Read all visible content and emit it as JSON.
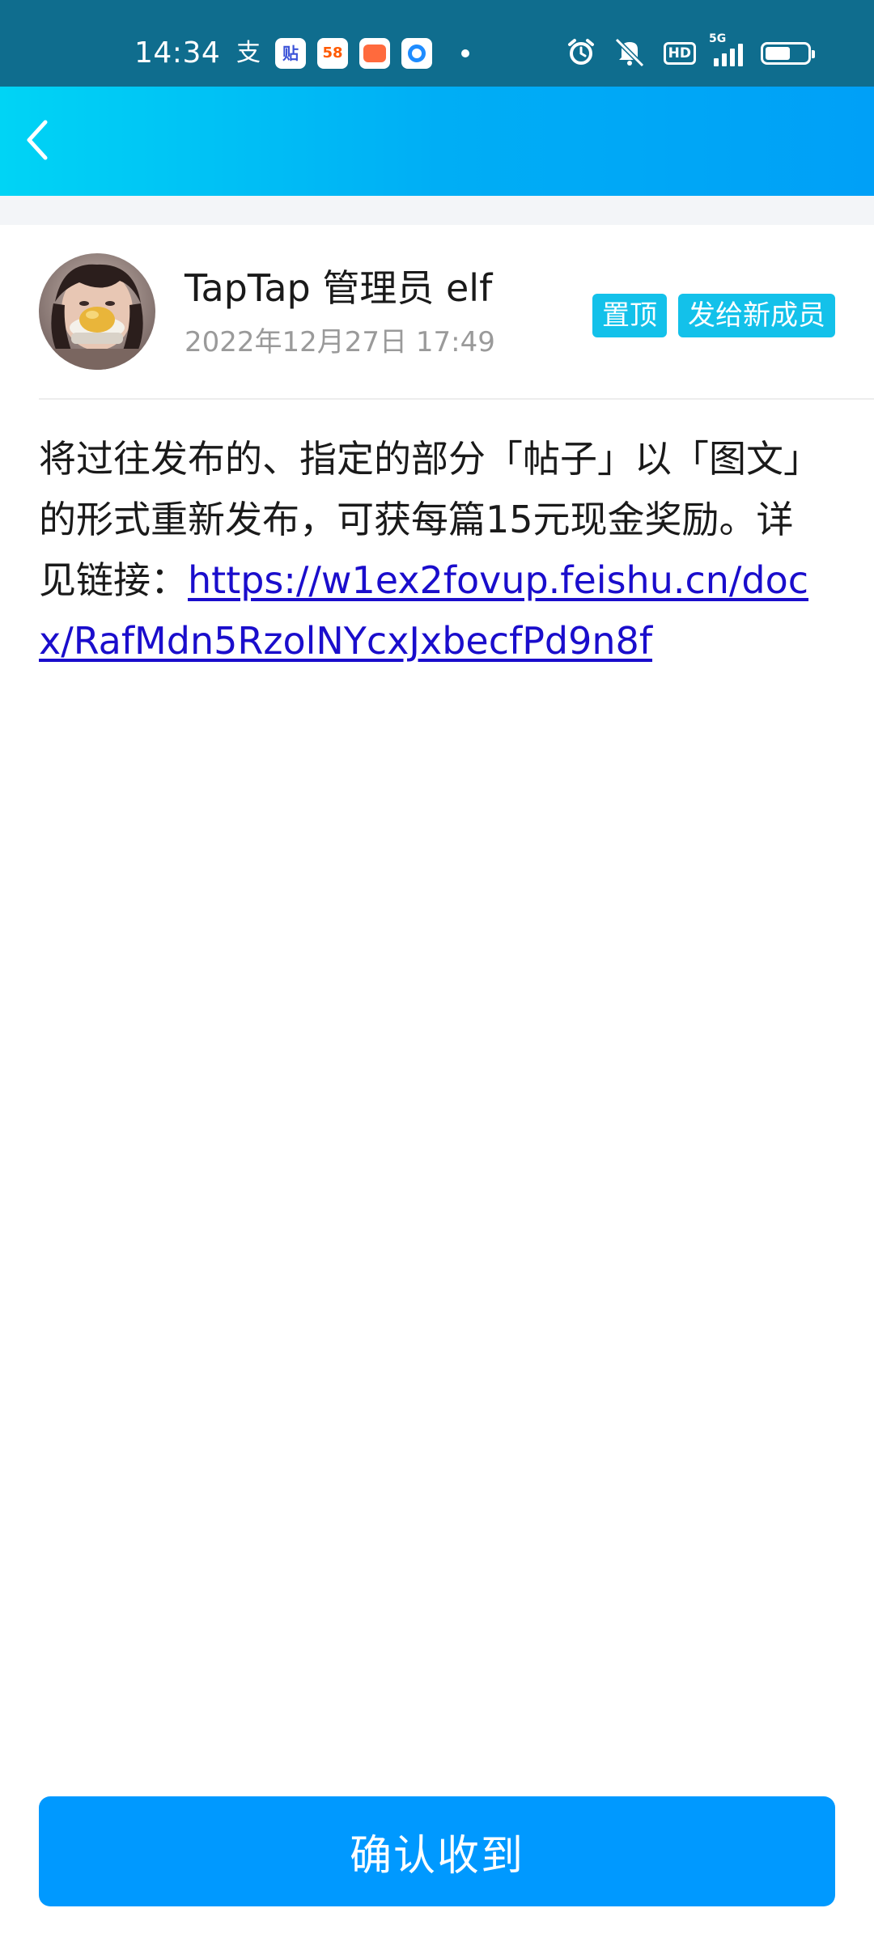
{
  "status_bar": {
    "time": "14:34",
    "icons_left": [
      "alipay-icon",
      "tieba-icon",
      "58-app-icon",
      "game-center-icon",
      "qq-browser-icon",
      "notification-dot"
    ],
    "icons_right": [
      "alarm-icon",
      "mute-icon",
      "hd-badge",
      "5g-signal-icon",
      "battery-icon"
    ],
    "tieba_glyph": "贴",
    "app58_glyph": "58",
    "hd_label": "HD",
    "network_label": "5G",
    "battery_level": 0.6
  },
  "header": {
    "back_icon": "chevron-left-icon",
    "background_gradient": [
      "#00d4f5",
      "#00a0f7"
    ]
  },
  "post": {
    "author_name": "TapTap 管理员 elf",
    "time": "2022年12月27日 17:49",
    "badges": [
      "置顶",
      "发给新成员"
    ],
    "body_text": "将过往发布的、指定的部分「帖子」以「图文」的形式重新发布，可获每篇15元现金奖励。详见链接：",
    "link": "https://w1ex2fovup.feishu.cn/docx/RafMdn5RzolNYcxJxbecfPd9n8f"
  },
  "confirm_button": {
    "label": "确认收到"
  },
  "colors": {
    "status_bar_bg": "#0f6d8e",
    "badge_bg": "#13c1ea",
    "confirm_bg": "#0099ff",
    "link": "#1a0dcc",
    "secondary_text": "#9a9a9a"
  }
}
